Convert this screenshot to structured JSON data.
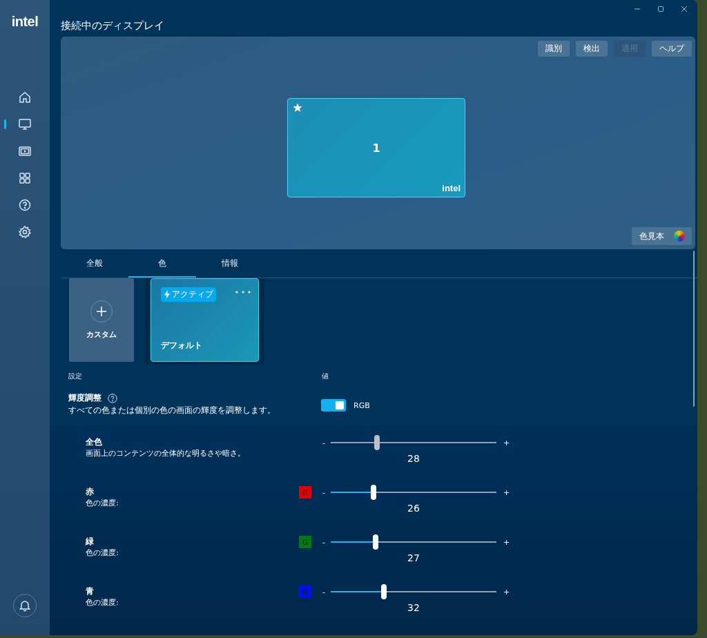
{
  "app": {
    "logo": "intel"
  },
  "window": {
    "title": "接続中のディスプレイ",
    "controls": [
      {
        "kind": "minimize"
      },
      {
        "kind": "maximize"
      },
      {
        "kind": "close"
      }
    ]
  },
  "sidebar": {
    "items": [
      {
        "kind": "home",
        "selected": false
      },
      {
        "kind": "display",
        "selected": true
      },
      {
        "kind": "video",
        "selected": false
      },
      {
        "kind": "apps",
        "selected": false
      },
      {
        "kind": "help",
        "selected": false
      },
      {
        "kind": "settings",
        "selected": false
      }
    ],
    "bottom_items": [
      {
        "kind": "notifications"
      }
    ]
  },
  "preview": {
    "buttons": [
      {
        "label": "識別",
        "disabled": false
      },
      {
        "label": "検出",
        "disabled": false
      },
      {
        "label": "適用",
        "disabled": true
      },
      {
        "label": "ヘルプ",
        "disabled": false
      }
    ],
    "display": {
      "number": "1",
      "primary": true,
      "brand": "intel"
    },
    "palette_button": "色見本"
  },
  "tabs": [
    {
      "label": "全般",
      "selected": false
    },
    {
      "label": "色",
      "selected": true
    },
    {
      "label": "情報",
      "selected": false
    }
  ],
  "profiles": [
    {
      "kind": "add",
      "label": "カスタム",
      "selected": false
    },
    {
      "kind": "preset",
      "label": "デフォルト",
      "selected": true,
      "badge": "アクティブ"
    }
  ],
  "settings": {
    "column_1": "設定",
    "column_2": "値",
    "brightness": {
      "title": "輝度調整",
      "description": "すべての色または個別の色の画面の輝度を調整します。",
      "on": true,
      "toggle_label": "RGB"
    },
    "sliders": [
      {
        "title": "全色",
        "description": "画面上のコンテンツの全体的な明るさや暗さ。",
        "disabled": true,
        "decrease": "-",
        "increase": "+",
        "level": 0.28,
        "reading": "28"
      },
      {
        "title": "赤",
        "description": "色の濃度:",
        "swatch": "R",
        "color": "#e00000",
        "disabled": false,
        "decrease": "-",
        "increase": "+",
        "level": 0.26,
        "reading": "26"
      },
      {
        "title": "緑",
        "description": "色の濃度:",
        "swatch": "G",
        "color": "#007a10",
        "disabled": false,
        "decrease": "-",
        "increase": "+",
        "level": 0.27,
        "reading": "27"
      },
      {
        "title": "青",
        "description": "色の濃度:",
        "swatch": "B",
        "color": "#0010e8",
        "disabled": false,
        "decrease": "-",
        "increase": "+",
        "level": 0.32,
        "reading": "32"
      }
    ]
  }
}
